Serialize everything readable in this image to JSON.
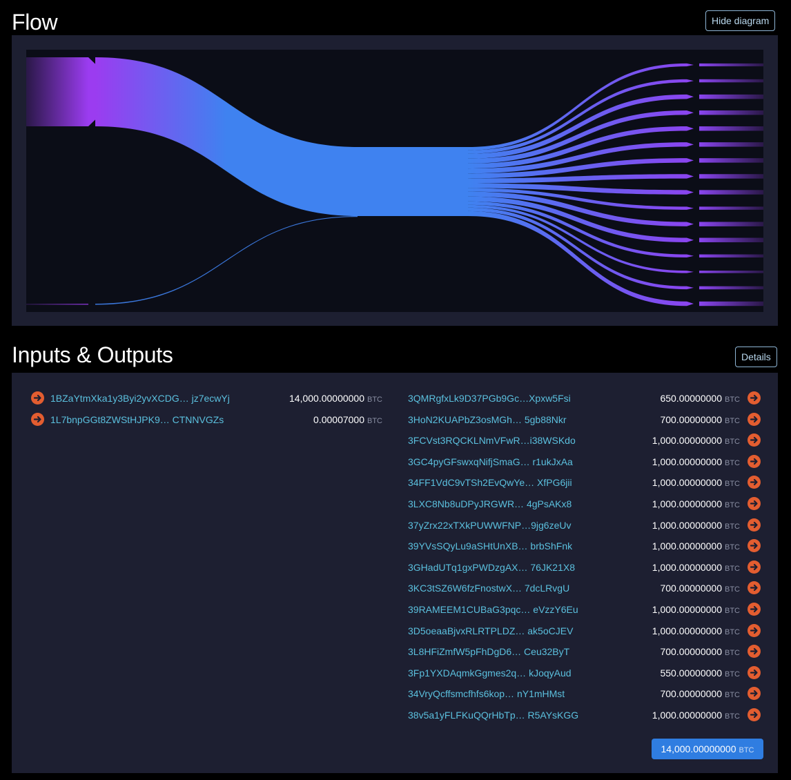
{
  "flow": {
    "title": "Flow",
    "hide_button": "Hide diagram",
    "colors": {
      "input": "#9b3cf0",
      "center": "#3f82f0",
      "output": "#8a45f0"
    }
  },
  "io": {
    "title": "Inputs & Outputs",
    "details_button": "Details",
    "unit": "BTC",
    "inputs": [
      {
        "address": "1BZaYtmXka1y3Byi2yvXCDG… jz7ecwYj",
        "amount": "14,000.00000000",
        "value": 14000
      },
      {
        "address": "1L7bnpGGt8ZWStHJPK9… CTNNVGZs",
        "amount": "0.00007000",
        "value": 7e-05
      }
    ],
    "outputs": [
      {
        "address": "3QMRgfxLk9D37PGb9Gc…Xpxw5Fsi",
        "amount": "650.00000000",
        "value": 650
      },
      {
        "address": "3HoN2KUAPbZ3osMGh… 5gb88Nkr",
        "amount": "700.00000000",
        "value": 700
      },
      {
        "address": "3FCVst3RQCKLNmVFwR…i38WSKdo",
        "amount": "1,000.00000000",
        "value": 1000
      },
      {
        "address": "3GC4pyGFswxqNifjSmaG… r1ukJxAa",
        "amount": "1,000.00000000",
        "value": 1000
      },
      {
        "address": "34FF1VdC9vTSh2EvQwYe… XfPG6jii",
        "amount": "1,000.00000000",
        "value": 1000
      },
      {
        "address": "3LXC8Nb8uDPyJRGWR… 4gPsAKx8",
        "amount": "1,000.00000000",
        "value": 1000
      },
      {
        "address": "37yZrx22xTXkPUWWFNP…9jg6zeUv",
        "amount": "1,000.00000000",
        "value": 1000
      },
      {
        "address": "39YVsSQyLu9aSHtUnXB… brbShFnk",
        "amount": "1,000.00000000",
        "value": 1000
      },
      {
        "address": "3GHadUTq1gxPWDzgAX… 76JK21X8",
        "amount": "1,000.00000000",
        "value": 1000
      },
      {
        "address": "3KC3tSZ6W6fzFnostwX… 7dcLRvgU",
        "amount": "700.00000000",
        "value": 700
      },
      {
        "address": "39RAMEEM1CUBaG3pqc… eVzzY6Eu",
        "amount": "1,000.00000000",
        "value": 1000
      },
      {
        "address": "3D5oeaaBjvxRLRTPLDZ… ak5oCJEV",
        "amount": "1,000.00000000",
        "value": 1000
      },
      {
        "address": "3L8HFiZmfW5pFhDgD6… Ceu32ByT",
        "amount": "700.00000000",
        "value": 700
      },
      {
        "address": "3Fp1YXDAqmkGgmes2q… kJoqyAud",
        "amount": "550.00000000",
        "value": 550
      },
      {
        "address": "34VryQcffsmcfhfs6kop… nY1mHMst",
        "amount": "700.00000000",
        "value": 700
      },
      {
        "address": "38v5a1yFLFKuQQrHbTp… R5AYsKGG",
        "amount": "1,000.00000000",
        "value": 1000
      }
    ],
    "total": "14,000.00000000"
  }
}
